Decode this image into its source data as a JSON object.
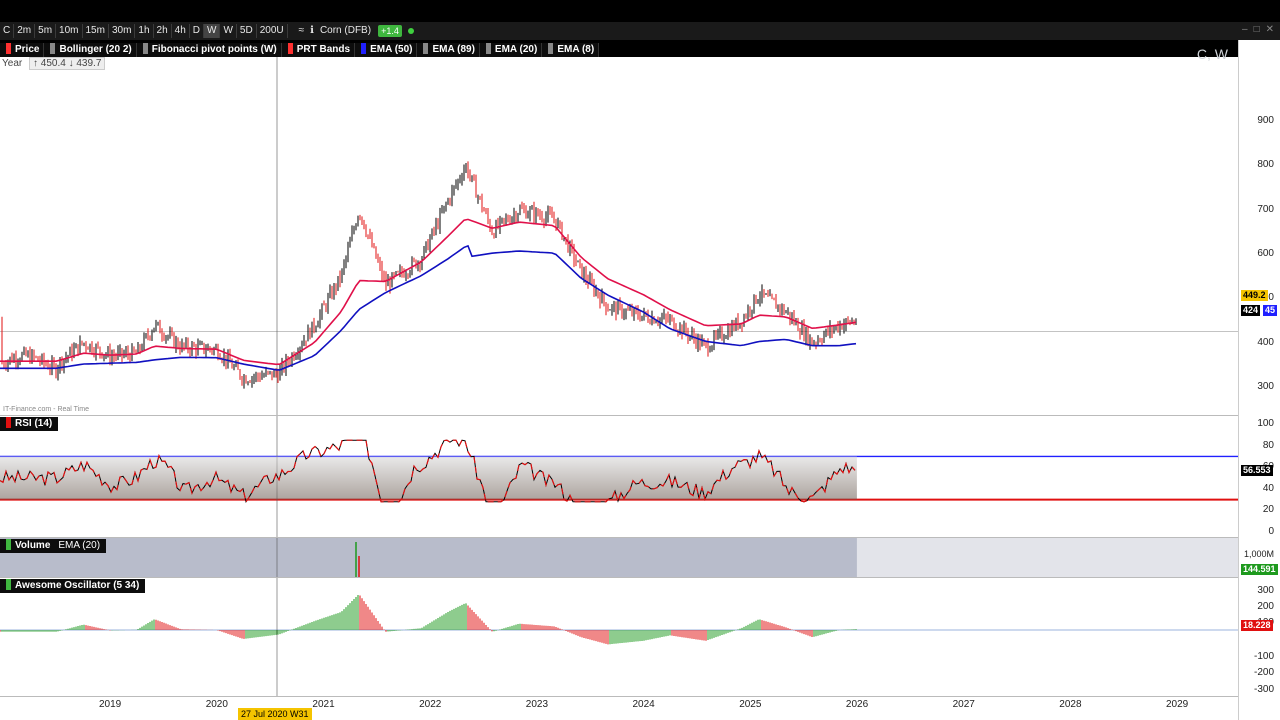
{
  "toolbar": {
    "items": [
      "C",
      "2m",
      "5m",
      "10m",
      "15m",
      "30m",
      "1h",
      "2h",
      "4h",
      "D",
      "W",
      "W",
      "5D",
      "200U"
    ],
    "instrument": "Corn (DFB)",
    "change": "+1.4"
  },
  "indicators": [
    {
      "label": "Price",
      "color": "#ff3030"
    },
    {
      "label": "Bollinger (20 2)",
      "color": "#888888"
    },
    {
      "label": "Fibonacci pivot points (W)",
      "color": "#888888"
    },
    {
      "label": "PRT Bands",
      "color": "#ff3030"
    },
    {
      "label": "EMA (50)",
      "color": "#2020ff"
    },
    {
      "label": "EMA (89)",
      "color": "#888888"
    },
    {
      "label": "EMA (20)",
      "color": "#888888"
    },
    {
      "label": "EMA (8)",
      "color": "#888888"
    }
  ],
  "year_tag": {
    "label": "Year",
    "values": "↑ 450.4 ↓ 439.7"
  },
  "watermark": "C, W",
  "source": "IT-Finance.com - Real Time",
  "price_axis": {
    "ticks": [
      "900",
      "800",
      "700",
      "600",
      "500",
      "400",
      "300"
    ],
    "tag1": "449.2",
    "tag2": "424",
    "tag2b": "45"
  },
  "rsi": {
    "label": "RSI (14)",
    "ticks": [
      "100",
      "80",
      "60",
      "40",
      "20",
      "0"
    ],
    "tag": "56.553"
  },
  "volume": {
    "label": "Volume",
    "ema": "EMA (20)",
    "ticks": [
      "1,000M"
    ],
    "tag": "144.591"
  },
  "ao": {
    "label": "Awesome Oscillator (5 34)",
    "ticks": [
      "300",
      "200",
      "100",
      "-100",
      "-200",
      "-300"
    ],
    "tag": "18.228"
  },
  "xaxis": {
    "labels": [
      "2019",
      "2020",
      "2021",
      "2022",
      "2023",
      "2024",
      "2025",
      "2026",
      "2027",
      "2028",
      "2029"
    ]
  },
  "crosshair_label": "27 Jul 2020 W31",
  "colors": {
    "price_up": "#000000",
    "price_down": "#e01010",
    "ema_red": "#e0104a",
    "ema_blue": "#1010c0",
    "rsi_high": "#2020ff",
    "rsi_low": "#e01010"
  },
  "chart_data": {
    "type": "line",
    "x": [
      "2018-07",
      "2018-10",
      "2019-01",
      "2019-04",
      "2019-06",
      "2019-09",
      "2020-01",
      "2020-04",
      "2020-08",
      "2020-12",
      "2021-03",
      "2021-05",
      "2021-08",
      "2021-12",
      "2022-03",
      "2022-05",
      "2022-08",
      "2022-11",
      "2023-03",
      "2023-06",
      "2023-09",
      "2024-01",
      "2024-04",
      "2024-08",
      "2024-12",
      "2025-02",
      "2025-05",
      "2025-08",
      "2025-11",
      "2026-01"
    ],
    "series": [
      {
        "values": [
          350,
          400,
          370,
          375,
          440,
          390,
          385,
          320,
          330,
          440,
          550,
          700,
          530,
          590,
          720,
          800,
          650,
          700,
          680,
          560,
          480,
          460,
          450,
          390,
          450,
          510,
          470,
          400,
          440,
          450
        ]
      },
      {
        "values": [
          360,
          370,
          372,
          374,
          380,
          386,
          385,
          370,
          355,
          390,
          450,
          500,
          540,
          580,
          620,
          650,
          660,
          665,
          660,
          600,
          560,
          520,
          480,
          450,
          440,
          450,
          455,
          440,
          440,
          445
        ]
      }
    ],
    "ylim": [
      250,
      950
    ]
  }
}
